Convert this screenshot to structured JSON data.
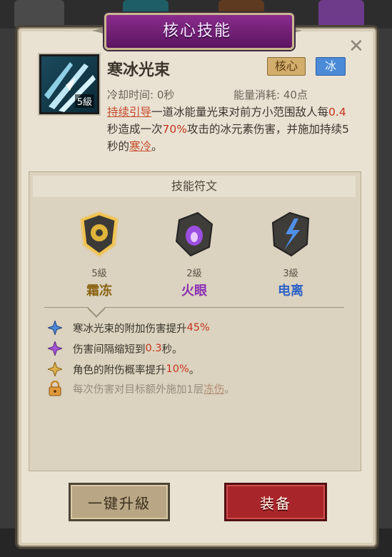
{
  "header": {
    "title": "核心技能"
  },
  "skill": {
    "level_badge": "5級",
    "name": "寒冰光束",
    "tags": {
      "core": "核心",
      "element": "冰"
    },
    "cooldown": "冷却时间: 0秒",
    "energy": "能量消耗: 40点",
    "desc": {
      "link1": "持续引导",
      "t1": "一道冰能量光束对前方小范围敌人每",
      "v1": "0.4",
      "t2": "秒造成一次",
      "v2": "70%",
      "t3": "攻击的冰元素伤害，并施加持续5秒的",
      "link2": "寒冷",
      "t4": "。"
    }
  },
  "runes": {
    "header": "技能符文",
    "items": [
      {
        "level": "5級",
        "name": "霜冻",
        "color": "#b8860b"
      },
      {
        "level": "2級",
        "name": "火眼",
        "color": "#8a2fb5"
      },
      {
        "level": "3級",
        "name": "电离",
        "color": "#2f63c8"
      }
    ]
  },
  "effects": [
    {
      "pre": "寒冰光束的附加伤害提升",
      "val": "45%",
      "post": "",
      "icon": "blue-star-icon"
    },
    {
      "pre": "伤害间隔缩短到",
      "val": "0.3",
      "post": "秒。",
      "icon": "purple-star-icon"
    },
    {
      "pre": "角色的附伤概率提升",
      "val": "10%",
      "post": "。",
      "icon": "gold-star-icon"
    },
    {
      "pre": "每次伤害对目标额外施加1层",
      "val": "冻伤",
      "post": "。",
      "icon": "lock-icon"
    }
  ],
  "buttons": {
    "upgrade": "一键升級",
    "equip": "装备"
  },
  "colors": {
    "accent_purple": "#7a237e",
    "equip_red": "#a8262a",
    "ice_blue": "#4b8ad6"
  }
}
